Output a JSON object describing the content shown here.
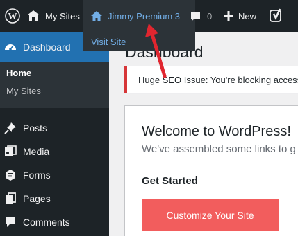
{
  "admin_bar": {
    "wp_logo_icon": "wordpress-logo",
    "my_sites_label": "My Sites",
    "site_name": "Jimmy Premium 3",
    "comments_count": "0",
    "new_label": "New",
    "yoast_icon": "yoast-logo"
  },
  "site_menu": {
    "visit_site": "Visit Site"
  },
  "sidebar": {
    "dashboard": "Dashboard",
    "submenu": {
      "home": "Home",
      "my_sites": "My Sites"
    },
    "items": [
      {
        "label": "Posts",
        "icon": "pushpin-icon"
      },
      {
        "label": "Media",
        "icon": "media-icon"
      },
      {
        "label": "Forms",
        "icon": "forms-icon"
      },
      {
        "label": "Pages",
        "icon": "pages-icon"
      },
      {
        "label": "Comments",
        "icon": "comment-icon"
      }
    ]
  },
  "main": {
    "page_title": "Dashboard",
    "notice_text": "Huge SEO Issue: You're blocking access",
    "welcome": {
      "title": "Welcome to WordPress!",
      "subtitle": "We've assembled some links to g",
      "get_started": "Get Started",
      "customize_button": "Customize Your Site"
    }
  },
  "colors": {
    "admin_bar_bg": "#1d2327",
    "accent": "#2271b1",
    "link": "#72aee6",
    "notice_border": "#d63638",
    "customize_button": "#f25d5d",
    "arrow": "#e0262f"
  }
}
